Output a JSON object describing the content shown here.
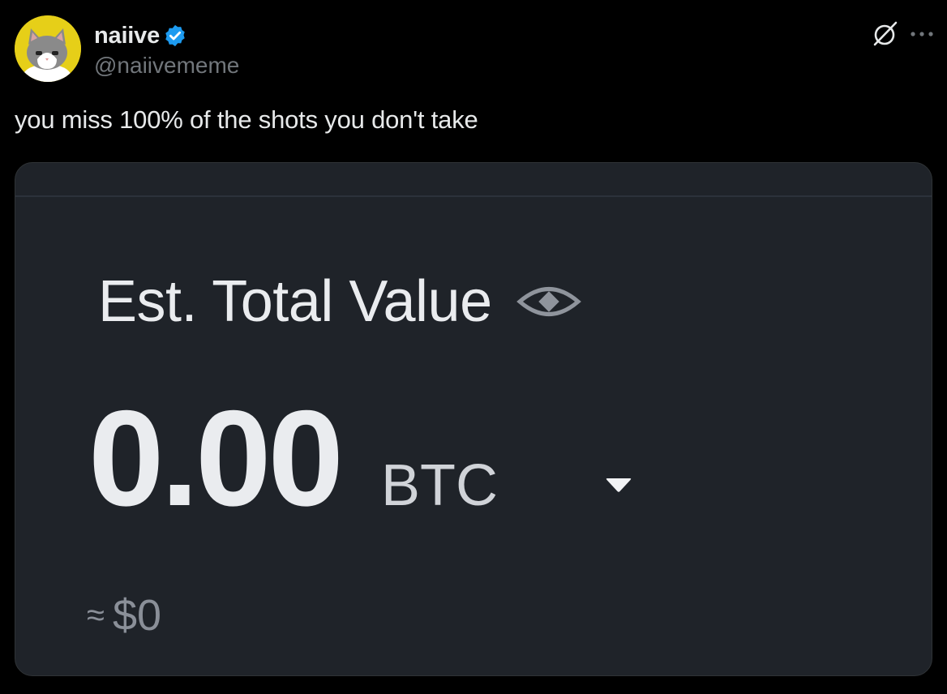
{
  "author": {
    "display_name": "naiive",
    "handle": "@naiivememe",
    "avatar_icon": "cat-avatar",
    "verified_icon": "verified-badge-icon",
    "verified_color": "#1d9bf0"
  },
  "top_actions": {
    "grok_icon": "grok-icon",
    "more_icon": "more-options-icon"
  },
  "tweet": {
    "text": "you miss 100% of the shots you don't take"
  },
  "media": {
    "est_label": "Est. Total Value",
    "eye_icon": "eye-icon",
    "value": "0.00",
    "currency": "BTC",
    "dropdown_icon": "caret-down-icon",
    "approx_symbol": "≈",
    "approx_value": "$0"
  },
  "colors": {
    "background": "#000000",
    "card_bg": "#1f2329",
    "text_primary": "#e7e9ea",
    "text_secondary": "#71767b"
  }
}
